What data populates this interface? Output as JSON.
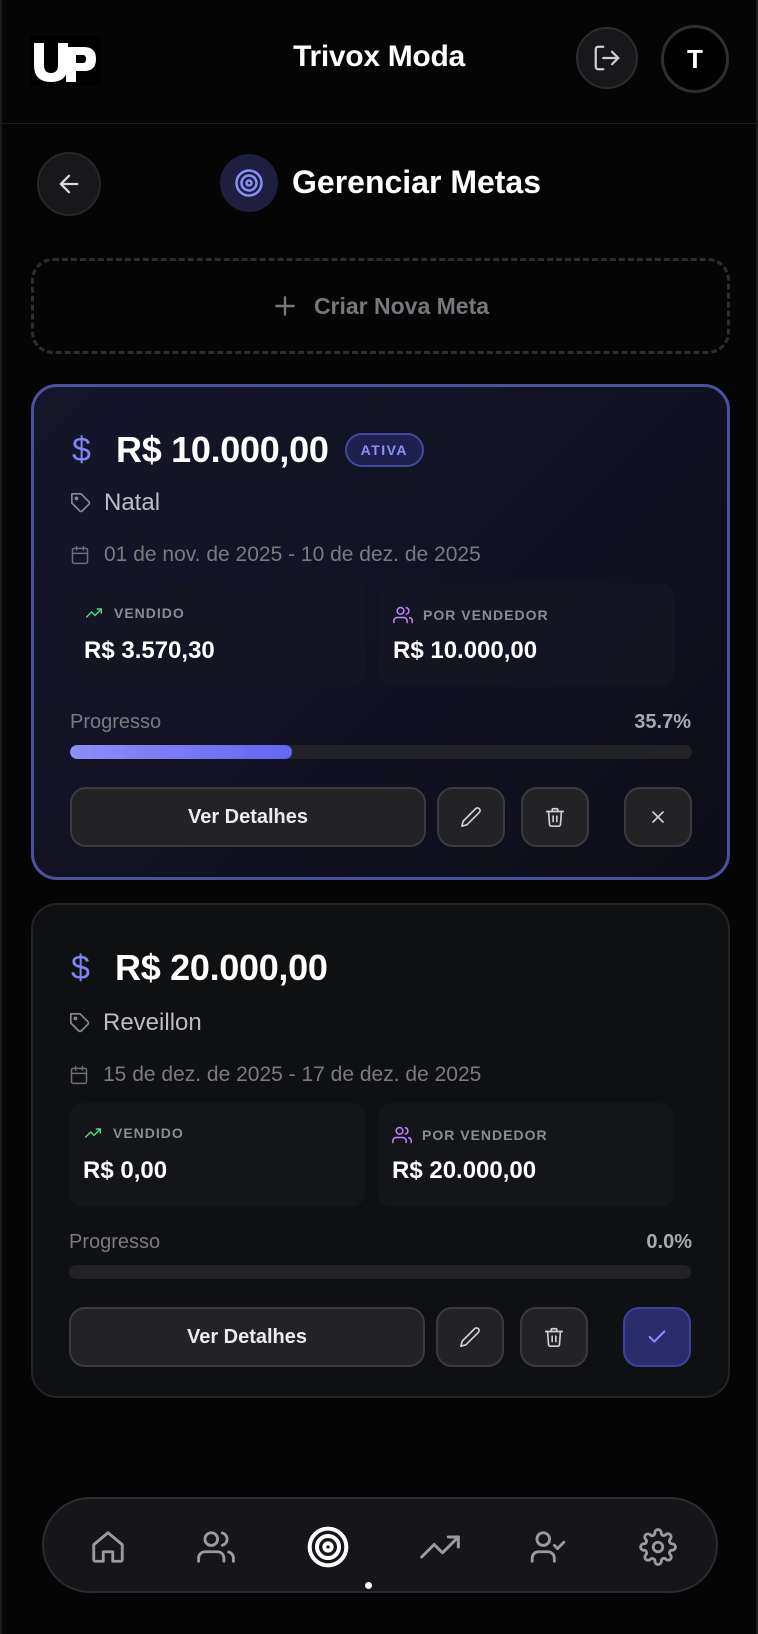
{
  "header": {
    "title": "Trivox Moda",
    "avatar_initial": "T",
    "logo_text": "UP"
  },
  "page": {
    "title": "Gerenciar Metas",
    "create_label": "Criar Nova Meta"
  },
  "goals": [
    {
      "amount": "R$ 10.000,00",
      "status_badge": "ATIVA",
      "name": "Natal",
      "period": "01 de nov. de 2025 - 10 de dez. de 2025",
      "sold_label": "VENDIDO",
      "sold_value": "R$ 3.570,30",
      "per_seller_label": "POR VENDEDOR",
      "per_seller_value": "R$ 10.000,00",
      "progress_label": "Progresso",
      "progress_text": "35.7%",
      "progress_fraction": 0.357,
      "details_label": "Ver Detalhes",
      "active": true
    },
    {
      "amount": "R$ 20.000,00",
      "name": "Reveillon",
      "period": "15 de dez. de 2025 - 17 de dez. de 2025",
      "sold_label": "VENDIDO",
      "sold_value": "R$ 0,00",
      "per_seller_label": "POR VENDEDOR",
      "per_seller_value": "R$ 20.000,00",
      "progress_label": "Progresso",
      "progress_text": "0.0%",
      "progress_fraction": 0.0,
      "details_label": "Ver Detalhes",
      "active": false
    }
  ],
  "nav": {
    "items": [
      "home-icon",
      "users-icon",
      "target-icon",
      "trending-up-icon",
      "user-check-icon",
      "settings-icon"
    ],
    "active_item": "target-icon"
  },
  "colors": {
    "accent": "#6366f1",
    "success": "#4ade80",
    "purple": "#c084fc",
    "background": "#050505"
  }
}
